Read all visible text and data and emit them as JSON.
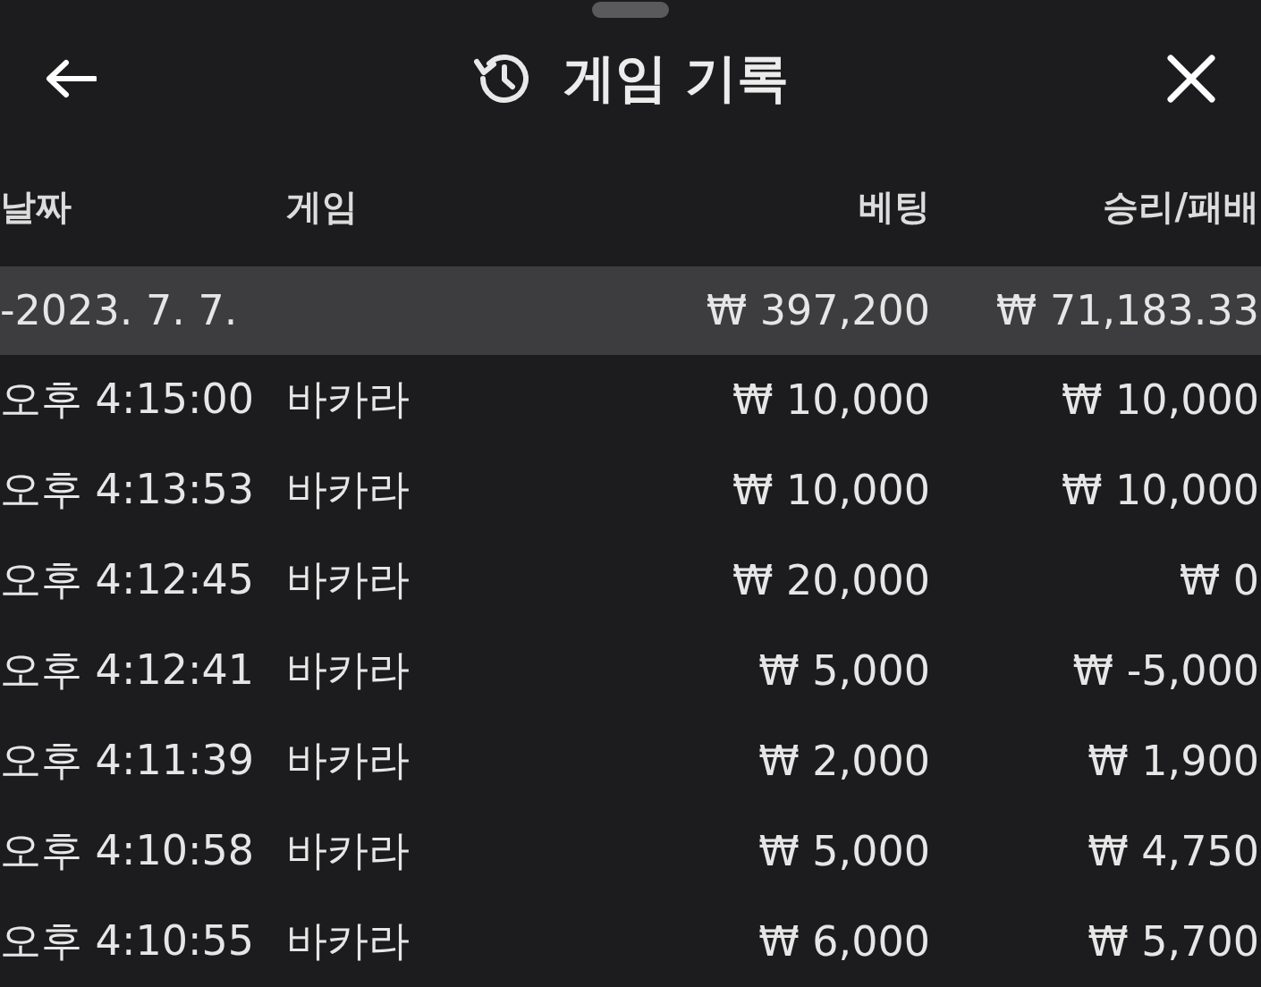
{
  "header": {
    "title": "게임 기록"
  },
  "table": {
    "columns": [
      "날짜",
      "게임",
      "베팅",
      "승리/패배"
    ],
    "rows": [
      {
        "kind": "summary",
        "date": "-2023. 7. 7.",
        "game": "",
        "bet": "₩ 397,200",
        "result": "₩ 71,183.33"
      },
      {
        "kind": "entry",
        "date": "오후 4:15:00",
        "game": "바카라",
        "bet": "₩ 10,000",
        "result": "₩ 10,000"
      },
      {
        "kind": "entry",
        "date": "오후 4:13:53",
        "game": "바카라",
        "bet": "₩ 10,000",
        "result": "₩ 10,000"
      },
      {
        "kind": "entry",
        "date": "오후 4:12:45",
        "game": "바카라",
        "bet": "₩ 20,000",
        "result": "₩ 0"
      },
      {
        "kind": "entry",
        "date": "오후 4:12:41",
        "game": "바카라",
        "bet": "₩ 5,000",
        "result": "₩ -5,000"
      },
      {
        "kind": "entry",
        "date": "오후 4:11:39",
        "game": "바카라",
        "bet": "₩ 2,000",
        "result": "₩ 1,900"
      },
      {
        "kind": "entry",
        "date": "오후 4:10:58",
        "game": "바카라",
        "bet": "₩ 5,000",
        "result": "₩ 4,750"
      },
      {
        "kind": "entry",
        "date": "오후 4:10:55",
        "game": "바카라",
        "bet": "₩ 6,000",
        "result": "₩ 5,700"
      }
    ]
  }
}
